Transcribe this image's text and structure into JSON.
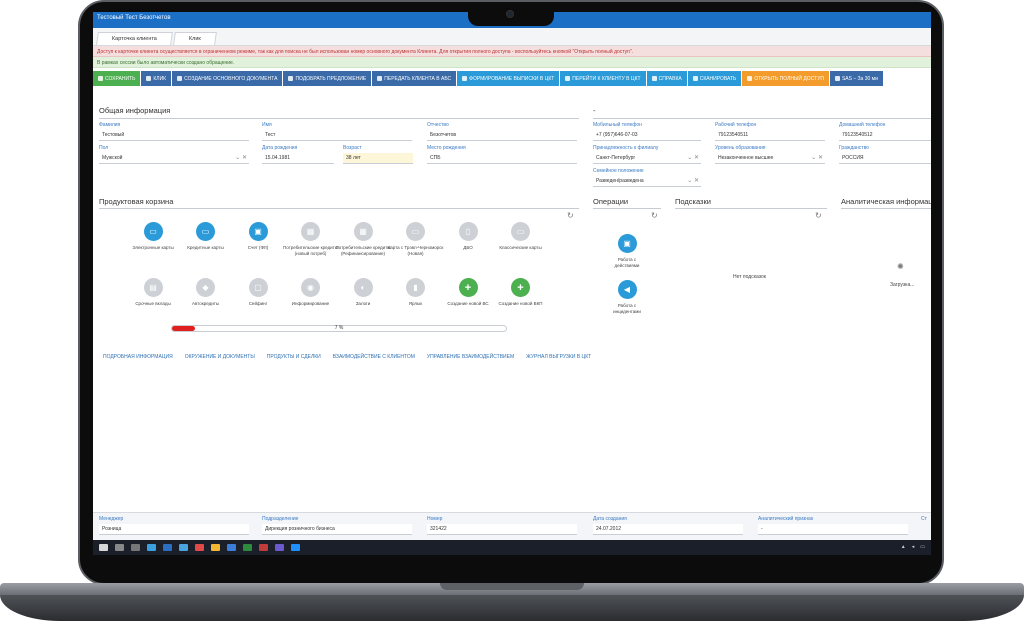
{
  "window": {
    "title": "Тестовый Тест Безотчетов"
  },
  "tabs": [
    {
      "label": "Карточка клиента"
    },
    {
      "label": "Клик"
    }
  ],
  "banners": {
    "red": "Доступ к карточке клиента осуществляется в ограниченном режиме, так как для поиска не был использован номер основного документа Клиента. Для открытия полного доступа - воспользуйтесь кнопкой \"Открыть полный доступ\".",
    "green": "В рамках сессии было автоматически создано обращение."
  },
  "toolbar": [
    {
      "label": "СОХРАНИТЬ",
      "color": "#4caf50"
    },
    {
      "label": "КЛИК",
      "color": "#3a6aa8"
    },
    {
      "label": "СОЗДАНИЕ ОСНОВНОГО ДОКУМЕНТА",
      "color": "#3a6aa8"
    },
    {
      "label": "ПОДОБРАТЬ ПРЕДЛОЖЕНИЕ",
      "color": "#3a6aa8"
    },
    {
      "label": "ПЕРЕДАТЬ КЛИЕНТА В АБС",
      "color": "#3a6aa8"
    },
    {
      "label": "ФОРМИРОВАНИЕ ВЫПИСКИ В ЦКТ",
      "color": "#2a9ad8"
    },
    {
      "label": "ПЕРЕЙТИ К КЛИЕНТУ В ЦКТ",
      "color": "#2a9ad8"
    },
    {
      "label": "СПРАВКА",
      "color": "#2a9ad8"
    },
    {
      "label": "СКАНИРОВАТЬ",
      "color": "#2a9ad8"
    },
    {
      "label": "ОТКРЫТЬ ПОЛНЫЙ ДОСТУП",
      "color": "#f39c2b"
    },
    {
      "label": "SAS – За 30 ми",
      "color": "#3a6aa8"
    }
  ],
  "general": {
    "title": "Общая информация",
    "surname_label": "Фамилия",
    "surname": "Тестовый",
    "name_label": "Имя",
    "name": "Тест",
    "patronymic_label": "Отчество",
    "patronymic": "Безотчетов",
    "gender_label": "Пол",
    "gender": "Мужской",
    "birthdate_label": "Дата рождения",
    "birthdate": "15.04.1981",
    "age_label": "Возраст",
    "age": "38 лет",
    "birthplace_label": "Место рождения",
    "birthplace": "СПБ"
  },
  "contacts": {
    "title": "-",
    "mobile_label": "Мобильный телефон",
    "mobile": "+7 (957)646-07-03",
    "work_label": "Рабочий телефон",
    "work": "79123540511",
    "home_label": "Домашний телефон",
    "home": "79123540512",
    "branch_label": "Принадлежность к филиалу",
    "branch": "Санкт-Петербург",
    "education_label": "Уровень образования",
    "education": "Незаконченное высшее",
    "citizenship_label": "Гражданство",
    "citizenship": "РОССИЯ",
    "marital_label": "Семейное положение",
    "marital": "Разведен/разведена"
  },
  "products": {
    "title": "Продуктовая корзина",
    "items": [
      {
        "label": "Электронные карты",
        "style": "blue",
        "glyph": "▭"
      },
      {
        "label": "Кредитные карты",
        "style": "blue",
        "glyph": "▭"
      },
      {
        "label": "Счет (ФЛ)",
        "style": "blue",
        "glyph": "▣"
      },
      {
        "label": "Потребительские кредиты (новый потреб)",
        "style": "gray",
        "glyph": "▦"
      },
      {
        "label": "Потребительские кредиты (Рефинансирование)",
        "style": "gray",
        "glyph": "▦"
      },
      {
        "label": "Карта с Трэвл-Черноморск (Новая)",
        "style": "gray",
        "glyph": "▭"
      },
      {
        "label": "ДБО",
        "style": "gray",
        "glyph": "▯"
      },
      {
        "label": "Классические карты",
        "style": "gray",
        "glyph": "▭"
      },
      {
        "label": "Срочные вклады",
        "style": "gray",
        "glyph": "▤"
      },
      {
        "label": "Автокредиты",
        "style": "gray",
        "glyph": "◆"
      },
      {
        "label": "Сейфинг",
        "style": "gray",
        "glyph": "▢"
      },
      {
        "label": "Информирование",
        "style": "gray",
        "glyph": "◉"
      },
      {
        "label": "Залоги",
        "style": "gray",
        "glyph": "◐"
      },
      {
        "label": "Ярлык",
        "style": "gray",
        "glyph": "▮"
      },
      {
        "label": "Создание новой ВС",
        "style": "green",
        "glyph": "+"
      },
      {
        "label": "Создание новой ВКП",
        "style": "green",
        "glyph": "+"
      }
    ],
    "progress": 0.07,
    "progress_text": "7 %"
  },
  "operations": {
    "title": "Операции",
    "items": [
      {
        "label": "Работа с действиями"
      },
      {
        "label": "Работа с инцидентами"
      }
    ]
  },
  "hints": {
    "title": "Подсказки",
    "empty": "Нет подсказок"
  },
  "analytics": {
    "title": "Аналитическая информаци",
    "loading": "Загрузка..."
  },
  "links": [
    "ПОДРОБНАЯ ИНФОРМАЦИЯ",
    "ОКРУЖЕНИЕ И ДОКУМЕНТЫ",
    "ПРОДУКТЫ И СДЕЛКИ",
    "ВЗАИМОДЕЙСТВИЕ С КЛИЕНТОМ",
    "УПРАВЛЕНИЕ ВЗАИМОДЕЙСТВИЕМ",
    "ЖУРНАЛ ВЫГРУЗКИ В ЦКТ"
  ],
  "footer": {
    "manager_label": "Менеджер",
    "manager": "Розница",
    "unit_label": "Подразделение",
    "unit": "Дирекция розничного бизнеса",
    "number_label": "Номер",
    "number": "321422",
    "created_label": "Дата создания",
    "created": "24.07.2012",
    "analytic_label": "Аналитический признак",
    "analytic": "-",
    "extra_label": "Ст"
  }
}
